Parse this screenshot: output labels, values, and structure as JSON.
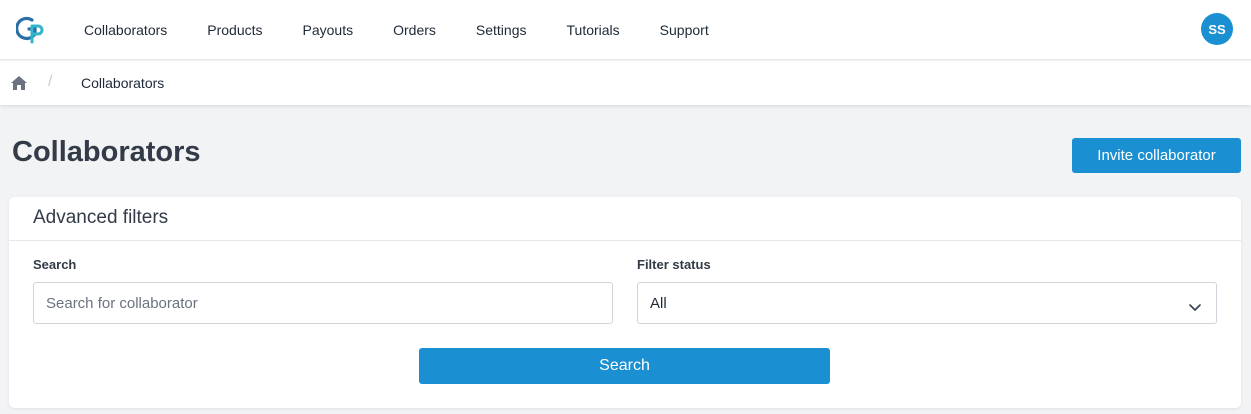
{
  "nav": {
    "items": [
      {
        "label": "Collaborators"
      },
      {
        "label": "Products"
      },
      {
        "label": "Payouts"
      },
      {
        "label": "Orders"
      },
      {
        "label": "Settings"
      },
      {
        "label": "Tutorials"
      },
      {
        "label": "Support"
      }
    ],
    "avatar_initials": "SS",
    "logo_icon": "gp-logo-icon"
  },
  "breadcrumb": {
    "home_icon": "home-icon",
    "separator": "/",
    "current": "Collaborators"
  },
  "page": {
    "title": "Collaborators",
    "invite_label": "Invite collaborator"
  },
  "filters": {
    "title": "Advanced filters",
    "search_label": "Search",
    "search_placeholder": "Search for collaborator",
    "search_value": "",
    "status_label": "Filter status",
    "status_value": "All",
    "submit_label": "Search"
  },
  "colors": {
    "accent": "#1a8fd1",
    "background": "#f2f3f5",
    "heading": "#333b48"
  }
}
